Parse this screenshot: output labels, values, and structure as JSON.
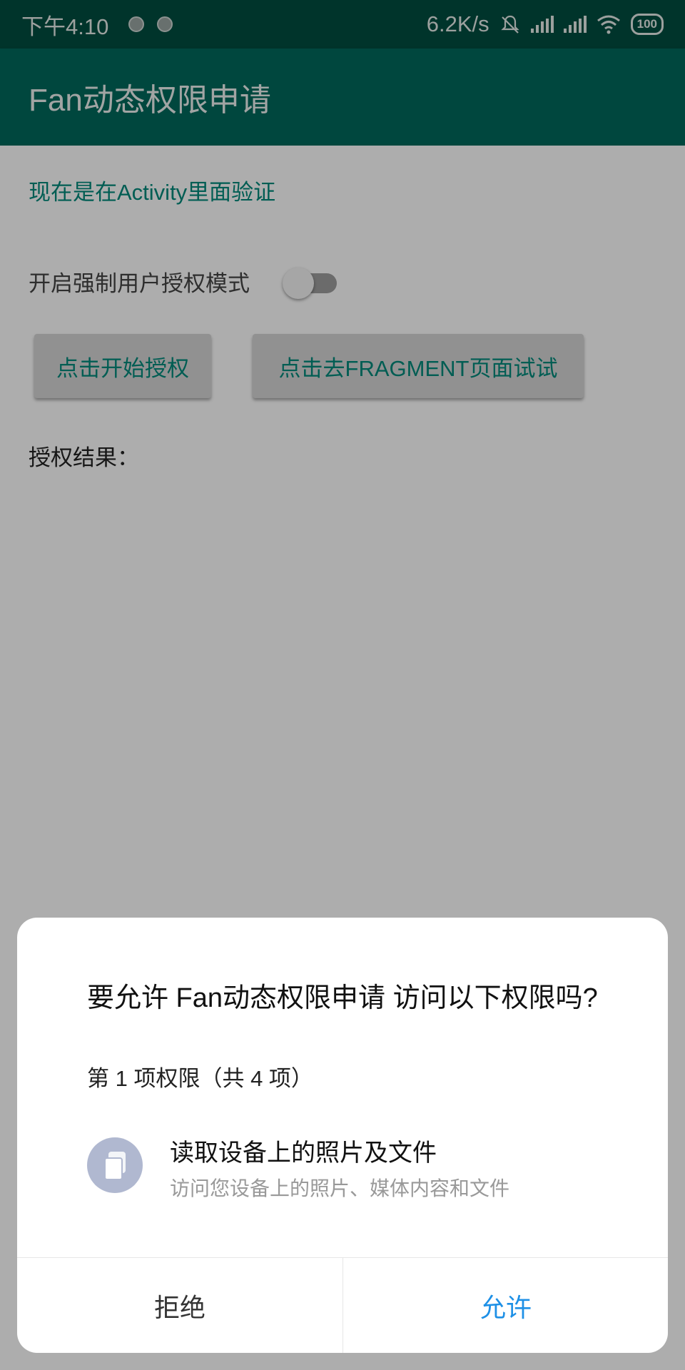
{
  "status_bar": {
    "time": "下午4:10",
    "net_speed": "6.2K/s",
    "battery": "100"
  },
  "app_bar": {
    "title": "Fan动态权限申请"
  },
  "main": {
    "verify_text": "现在是在Activity里面验证",
    "toggle_label": "开启强制用户授权模式",
    "toggle_on": false,
    "btn_start": "点击开始授权",
    "btn_fragment": "点击去FRAGMENT页面试试",
    "result_label": "授权结果："
  },
  "dialog": {
    "title": "要允许 Fan动态权限申请 访问以下权限吗?",
    "subtitle": "第 1 项权限（共 4 项）",
    "permission_icon": "documents-icon",
    "permission_title": "读取设备上的照片及文件",
    "permission_desc": "访问您设备上的照片、媒体内容和文件",
    "deny_label": "拒绝",
    "allow_label": "允许"
  },
  "colors": {
    "status_bar": "#004D40",
    "app_bar": "#00695C",
    "accent": "#00897B",
    "allow": "#1E90E6"
  }
}
